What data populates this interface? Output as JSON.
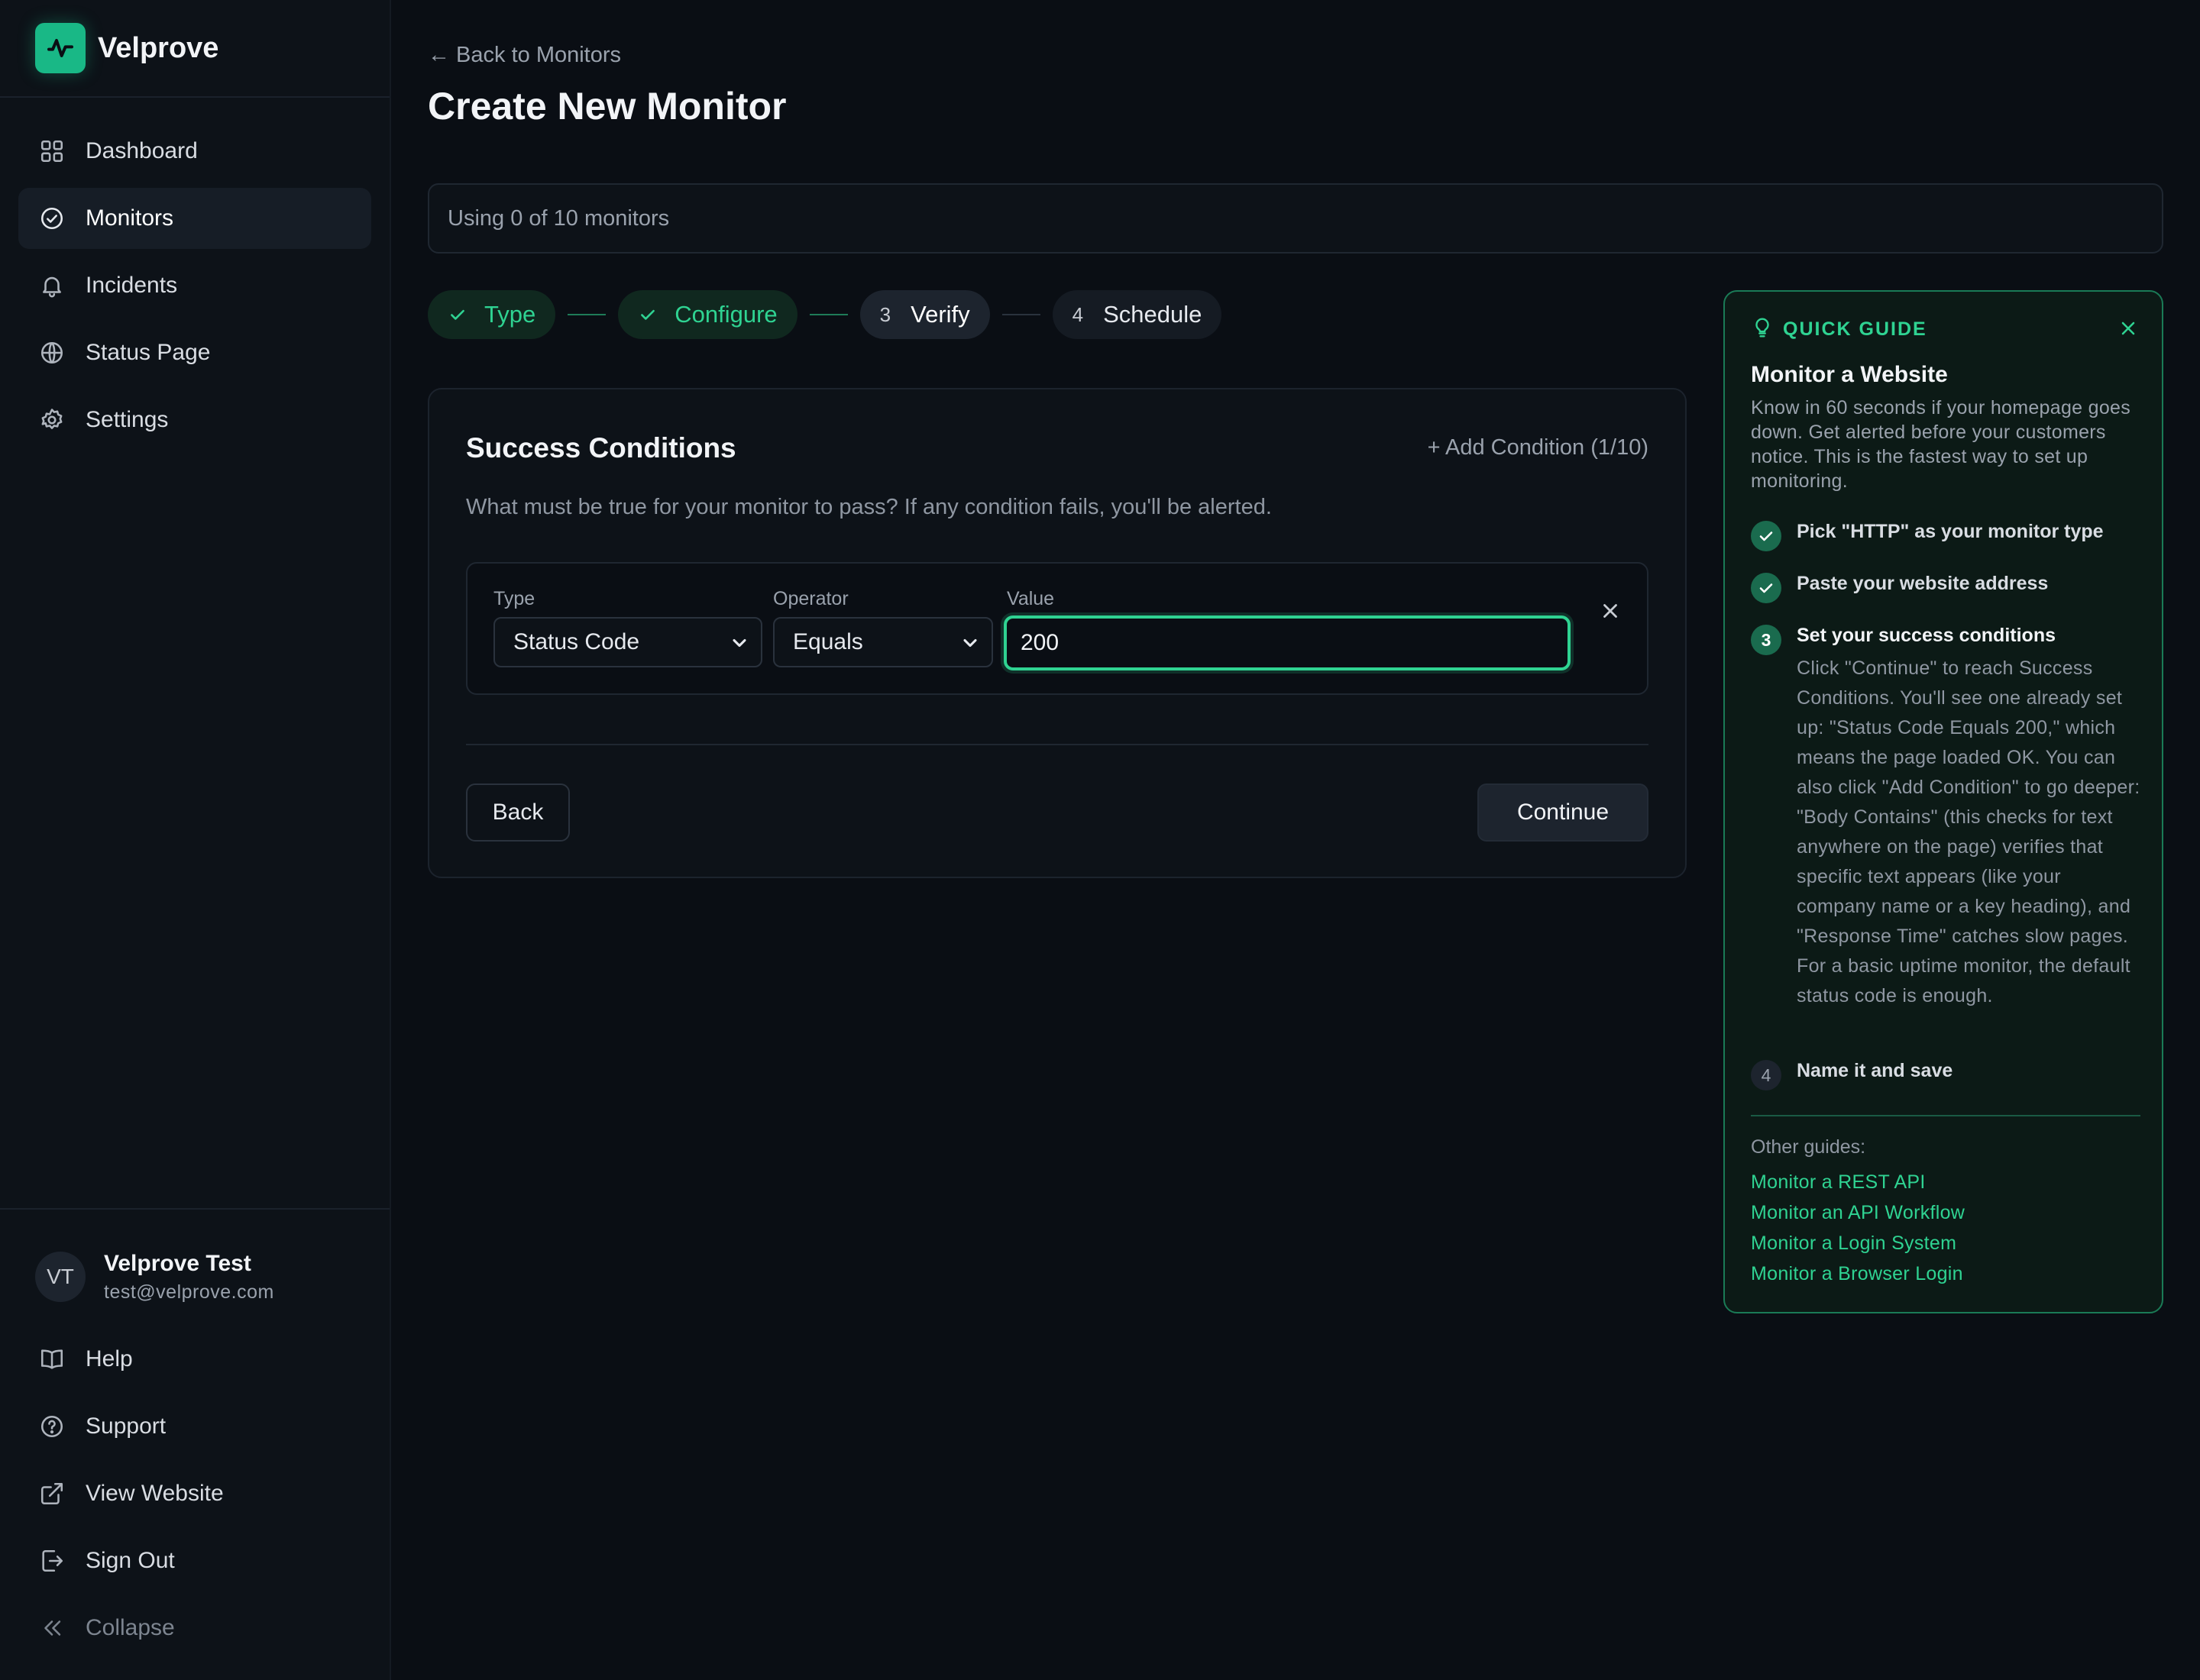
{
  "brand": {
    "name": "Velprove"
  },
  "sidebar": {
    "items": [
      {
        "label": "Dashboard",
        "icon": "grid-icon"
      },
      {
        "label": "Monitors",
        "icon": "check-circle-icon",
        "active": true
      },
      {
        "label": "Incidents",
        "icon": "bell-icon"
      },
      {
        "label": "Status Page",
        "icon": "globe-icon"
      },
      {
        "label": "Settings",
        "icon": "gear-icon"
      }
    ],
    "user": {
      "initials": "VT",
      "name": "Velprove Test",
      "email": "test@velprove.com"
    },
    "bottom_items": [
      {
        "label": "Help",
        "icon": "book-icon"
      },
      {
        "label": "Support",
        "icon": "help-circle-icon"
      },
      {
        "label": "View Website",
        "icon": "external-link-icon"
      },
      {
        "label": "Sign Out",
        "icon": "sign-out-icon"
      },
      {
        "label": "Collapse",
        "icon": "double-chevron-left-icon"
      }
    ]
  },
  "header": {
    "back_link": "← Back to Monitors",
    "title": "Create New Monitor"
  },
  "usage": {
    "text": "Using 0 of 10 monitors"
  },
  "stepper": {
    "steps": [
      {
        "number": "1",
        "label": "Type",
        "state": "done"
      },
      {
        "number": "2",
        "label": "Configure",
        "state": "done"
      },
      {
        "number": "3",
        "label": "Verify",
        "state": "current"
      },
      {
        "number": "4",
        "label": "Schedule",
        "state": "todo"
      }
    ]
  },
  "conditions": {
    "title": "Success Conditions",
    "add_label": "+ Add Condition (1/10)",
    "description": "What must be true for your monitor to pass? If any condition fails, you'll be alerted.",
    "row": {
      "type_label": "Type",
      "type_value": "Status Code",
      "operator_label": "Operator",
      "operator_value": "Equals",
      "value_label": "Value",
      "value": "200"
    },
    "back_label": "Back",
    "continue_label": "Continue"
  },
  "guide": {
    "caption": "QUICK GUIDE",
    "title": "Monitor a Website",
    "intro": "Know in 60 seconds if your homepage goes down. Get alerted before your customers notice. This is the fastest way to set up monitoring.",
    "steps": [
      {
        "number": "1",
        "title": "Pick \"HTTP\" as your monitor type",
        "state": "done",
        "desc": ""
      },
      {
        "number": "2",
        "title": "Paste your website address",
        "state": "done",
        "desc": ""
      },
      {
        "number": "3",
        "title": "Set your success conditions",
        "state": "current",
        "desc": "Click \"Continue\" to reach Success Conditions. You'll see one already set up: \"Status Code Equals 200,\" which means the page loaded OK. You can also click \"Add Condition\" to go deeper: \"Body Contains\" (this checks for text anywhere on the page) verifies that specific text appears (like your company name or a key heading), and \"Response Time\" catches slow pages. For a basic uptime monitor, the default status code is enough."
      },
      {
        "number": "4",
        "title": "Name it and save",
        "state": "todo",
        "desc": ""
      }
    ],
    "other_label": "Other guides:",
    "other_links": [
      "Monitor a REST API",
      "Monitor an API Workflow",
      "Monitor a Login System",
      "Monitor a Browser Login"
    ]
  },
  "colors": {
    "accent": "#2fd392",
    "background": "#0a0e14",
    "brand_logo": "#19b886"
  }
}
